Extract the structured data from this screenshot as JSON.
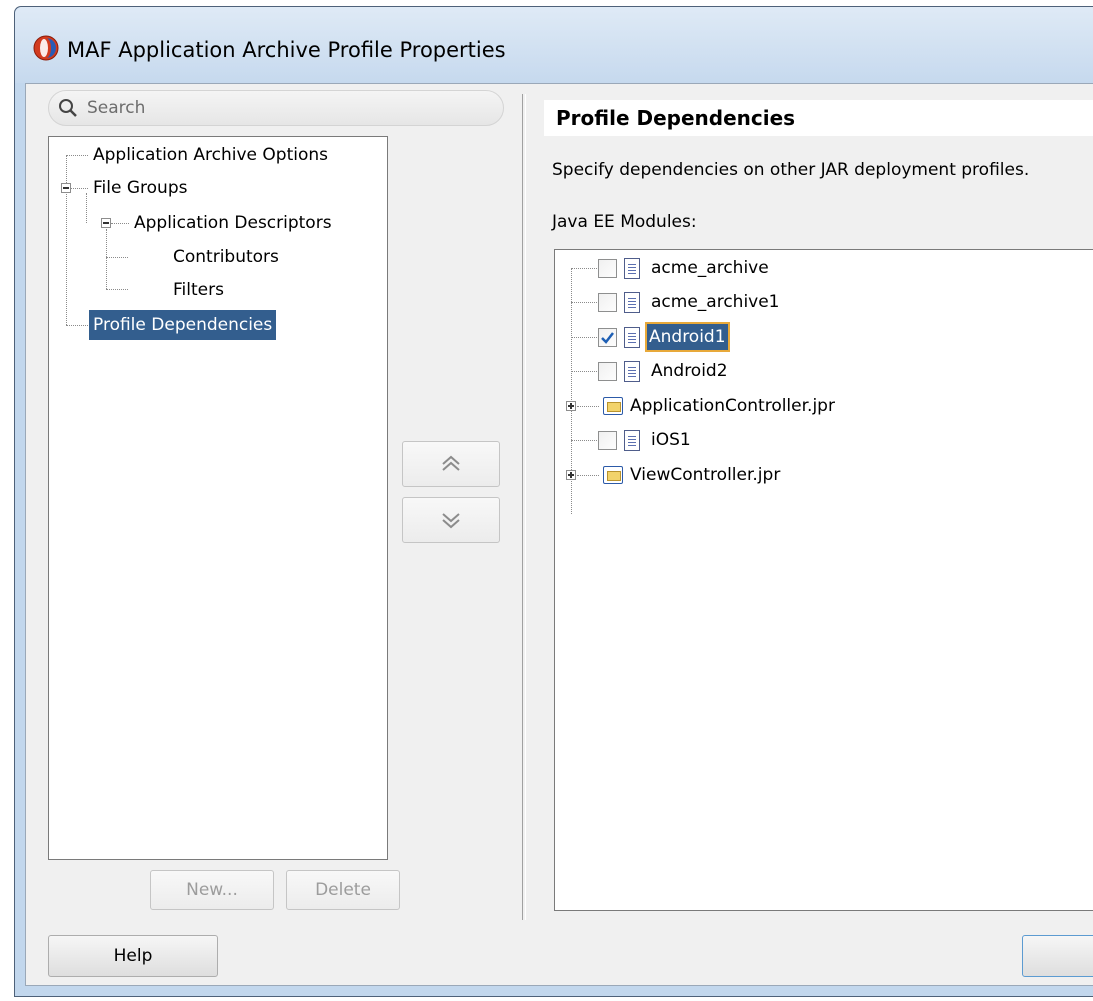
{
  "window": {
    "title": "MAF Application Archive Profile Properties"
  },
  "search": {
    "placeholder": "Search"
  },
  "nav_tree": {
    "items": [
      {
        "label": "Application Archive Options"
      },
      {
        "label": "File Groups"
      },
      {
        "label": "Application Descriptors"
      },
      {
        "label": "Contributors"
      },
      {
        "label": "Filters"
      },
      {
        "label": "Profile Dependencies",
        "selected": true
      }
    ]
  },
  "buttons": {
    "move_up": "⇑",
    "move_down": "⇓",
    "new_label": "New...",
    "delete_label": "Delete",
    "help_label": "Help"
  },
  "section": {
    "title": "Profile Dependencies",
    "description": "Specify dependencies on other JAR deployment profiles.",
    "modules_label": "Java EE Modules:"
  },
  "modules": [
    {
      "label": "acme_archive",
      "type": "profile",
      "checked": false
    },
    {
      "label": "acme_archive1",
      "type": "profile",
      "checked": false
    },
    {
      "label": "Android1",
      "type": "profile",
      "checked": true,
      "selected": true
    },
    {
      "label": "Android2",
      "type": "profile",
      "checked": false
    },
    {
      "label": "ApplicationController.jpr",
      "type": "project",
      "collapsed": true
    },
    {
      "label": "iOS1",
      "type": "profile",
      "checked": false
    },
    {
      "label": "ViewController.jpr",
      "type": "project",
      "collapsed": true
    }
  ],
  "colors": {
    "selection": "#335e8e",
    "focus": "#e8a93a",
    "window_frame": "#c2d7ed"
  }
}
